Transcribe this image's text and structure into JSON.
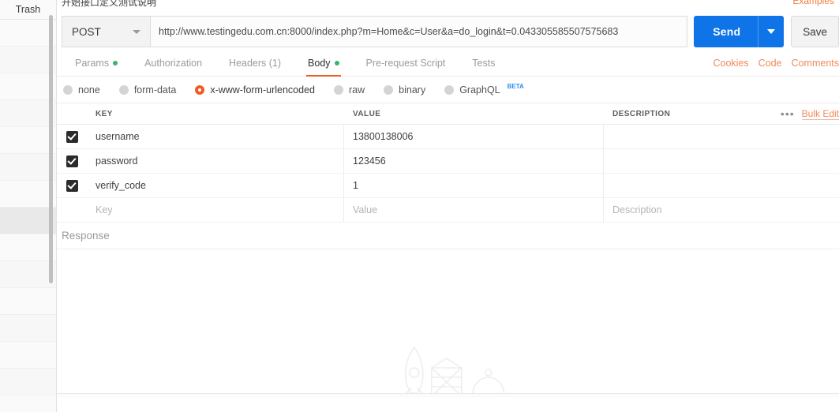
{
  "sidebar": {
    "trash_label": "Trash"
  },
  "topbar": {
    "cut_text": "开始接口定义测试说明",
    "examples_label": "Examples"
  },
  "request": {
    "method": "POST",
    "method_caret_icon": "chevron-down-icon",
    "url": "http://www.testingedu.com.cn:8000/index.php?m=Home&c=User&a=do_login&t=0.043305585507575683",
    "send_label": "Send",
    "send_caret_icon": "chevron-down-icon",
    "save_label": "Save"
  },
  "tabs": [
    {
      "label": "Params",
      "dot": true,
      "active": false,
      "name": "tab-params"
    },
    {
      "label": "Authorization",
      "dot": false,
      "active": false,
      "name": "tab-authorization"
    },
    {
      "label": "Headers (1)",
      "dot": false,
      "active": false,
      "name": "tab-headers"
    },
    {
      "label": "Body",
      "dot": true,
      "active": true,
      "name": "tab-body"
    },
    {
      "label": "Pre-request Script",
      "dot": false,
      "active": false,
      "name": "tab-pre-request-script"
    },
    {
      "label": "Tests",
      "dot": false,
      "active": false,
      "name": "tab-tests"
    }
  ],
  "tab_links": [
    {
      "label": "Cookies",
      "name": "cookies-link"
    },
    {
      "label": "Code",
      "name": "code-link"
    },
    {
      "label": "Comments",
      "name": "comments-link"
    }
  ],
  "body_types": [
    {
      "label": "none",
      "selected": false,
      "name": "body-type-none"
    },
    {
      "label": "form-data",
      "selected": false,
      "name": "body-type-form-data"
    },
    {
      "label": "x-www-form-urlencoded",
      "selected": true,
      "name": "body-type-x-www-form-urlencoded"
    },
    {
      "label": "raw",
      "selected": false,
      "name": "body-type-raw"
    },
    {
      "label": "binary",
      "selected": false,
      "name": "body-type-binary"
    },
    {
      "label": "GraphQL",
      "selected": false,
      "name": "body-type-graphql",
      "badge": "BETA"
    }
  ],
  "table": {
    "headers": {
      "key": "KEY",
      "value": "VALUE",
      "description": "DESCRIPTION"
    },
    "ellipsis_label": "•••",
    "bulk_edit_label": "Bulk Edit",
    "rows": [
      {
        "checked": true,
        "key": "username",
        "value": "13800138006",
        "description": ""
      },
      {
        "checked": true,
        "key": "password",
        "value": "123456",
        "description": ""
      },
      {
        "checked": true,
        "key": "verify_code",
        "value": "1",
        "description": ""
      }
    ],
    "placeholder_row": {
      "key": "Key",
      "value": "Value",
      "description": "Description"
    }
  },
  "response": {
    "label": "Response",
    "illustration": "rocket-launchpad-illustration"
  },
  "colors": {
    "accent_orange": "#ef5b25",
    "send_blue": "#0f74e8",
    "status_green": "#3bb273",
    "link_orange": "#f08a5d",
    "beta_blue": "#2d8fe8"
  }
}
